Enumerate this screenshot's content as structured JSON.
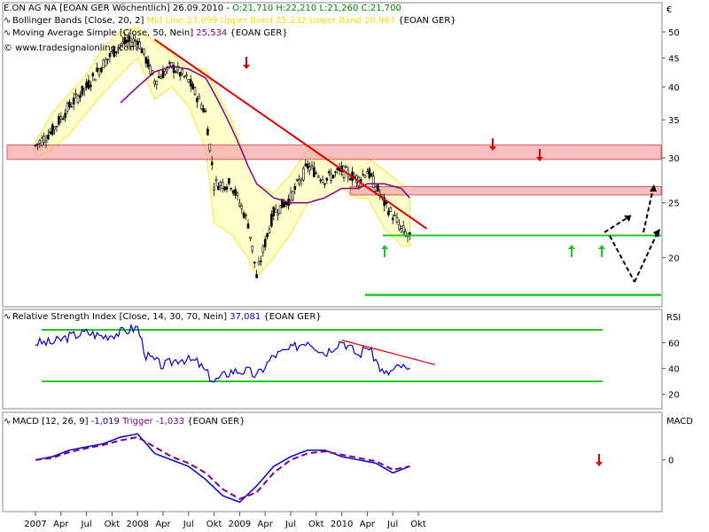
{
  "header": {
    "line1": {
      "name": "E.ON AG NA [EOAN GER  Wöchentlich]",
      "date": "26.09.2010",
      "sep": "-",
      "ohlc": "O:21,710 H:22,210 L:21,260 C:21,700"
    },
    "line2": {
      "name": "Bollinger Bands [Close, 20, 2]",
      "values": "Mid Line 23,099 Upper Band 25,232 Lower Band 20,967",
      "tag": "{EOAN GER}"
    },
    "line3": {
      "name": "Moving Average Simple [Close, 50, Nein]",
      "value": "25,534",
      "tag": "{EOAN GER}"
    },
    "line4": {
      "watermark": "© www.tradesignalonline.com"
    }
  },
  "rsi_header": {
    "name": "Relative Strength Index [Close, 14, 30, 70, Nein]",
    "value": "37,081",
    "tag": "{EOAN GER}"
  },
  "macd_header": {
    "name": "MACD [12, 26, 9]",
    "value": "-1,019",
    "trigger": "Trigger -1,033",
    "tag": "{EOAN GER}"
  },
  "axes": {
    "currency": "€",
    "price_ticks": [
      "50",
      "45",
      "40",
      "35",
      "30",
      "25",
      "20"
    ],
    "rsi_label": "RSI",
    "rsi_ticks": [
      "60",
      "40",
      "20"
    ],
    "macd_label": "MACD",
    "macd_ticks": [
      "0"
    ],
    "x_ticks": [
      "2007",
      "Apr",
      "Jul",
      "Okt",
      "2008",
      "Apr",
      "Jul",
      "Okt",
      "2009",
      "Apr",
      "Jul",
      "Okt",
      "2010",
      "Apr",
      "Jul",
      "Okt"
    ]
  },
  "colors": {
    "candle": "#000000",
    "bollinger_fill": "#ffffcc",
    "bollinger_line": "#ffd800",
    "sma": "#800080",
    "trendline": "#e00000",
    "zone_fill": "#f4a9a9",
    "support": "#22c422",
    "rsi": "#0000d0",
    "macd": "#0000d0",
    "trigger": "#800080"
  },
  "chart_data": [
    {
      "type": "line",
      "title": "E.ON AG NA [EOAN GER  Wöchentlich]",
      "x": [
        "2007-01",
        "2007-03",
        "2007-05",
        "2007-07",
        "2007-09",
        "2007-11",
        "2008-01",
        "2008-03",
        "2008-05",
        "2008-07",
        "2008-09",
        "2008-10",
        "2008-12",
        "2009-02",
        "2009-03",
        "2009-05",
        "2009-07",
        "2009-09",
        "2009-11",
        "2010-01",
        "2010-03",
        "2010-04",
        "2010-06",
        "2010-08",
        "2010-09"
      ],
      "series": [
        {
          "name": "Close",
          "values": [
            31.5,
            33.5,
            37,
            40,
            44,
            47.5,
            48.5,
            41,
            43.5,
            41,
            36,
            27,
            27,
            23,
            18.5,
            24,
            25.5,
            29,
            27.5,
            28.5,
            27.5,
            28.5,
            25,
            22.5,
            21.7
          ]
        },
        {
          "name": "Moving Average Simple [Close, 50, Nein]",
          "values": [
            null,
            null,
            null,
            null,
            null,
            37.5,
            40,
            42.5,
            43.5,
            43,
            41.5,
            39,
            34,
            29,
            27,
            25.5,
            25,
            25,
            25.5,
            26.5,
            26.5,
            27,
            27,
            26.5,
            25.5
          ]
        },
        {
          "name": "Upper Band",
          "values": [
            32,
            36,
            39,
            42,
            47,
            50,
            51,
            48,
            46,
            43,
            43,
            40,
            35,
            29,
            27,
            26,
            28,
            31,
            30,
            30,
            30,
            30,
            28.5,
            27,
            25.2
          ]
        },
        {
          "name": "Lower Band",
          "values": [
            30,
            31,
            33,
            36,
            39,
            42,
            45,
            38,
            40,
            37,
            31,
            23,
            22,
            20,
            18.5,
            20,
            22,
            25,
            25.5,
            26.5,
            25.5,
            25.5,
            22.5,
            21,
            21
          ]
        }
      ],
      "resistance_zones": [
        [
          29.8,
          31.6
        ],
        [
          25.8,
          26.7
        ]
      ],
      "support_levels": [
        21.9,
        17.2
      ],
      "trendline": [
        [
          "2008-03",
          48.5
        ],
        [
          "2010-11",
          22.5
        ]
      ],
      "ylim": [
        17,
        52
      ],
      "scale": "log"
    },
    {
      "type": "line",
      "title": "Relative Strength Index [Close, 14, 30, 70, Nein]",
      "x": [
        "2007-01",
        "2007-03",
        "2007-05",
        "2007-07",
        "2007-09",
        "2007-11",
        "2008-01",
        "2008-02",
        "2008-04",
        "2008-06",
        "2008-08",
        "2008-10",
        "2008-12",
        "2009-02",
        "2009-03",
        "2009-05",
        "2009-07",
        "2009-09",
        "2009-11",
        "2010-01",
        "2010-03",
        "2010-04",
        "2010-06",
        "2010-08",
        "2010-09"
      ],
      "series": [
        {
          "name": "RSI",
          "values": [
            60,
            60,
            65,
            68,
            65,
            68,
            72,
            50,
            42,
            48,
            45,
            30,
            38,
            38,
            34,
            50,
            55,
            62,
            52,
            62,
            50,
            58,
            35,
            42,
            37
          ]
        }
      ],
      "levels": [
        70,
        30
      ],
      "trendline": [
        [
          "2010-01",
          62
        ],
        [
          "2010-12",
          43
        ]
      ],
      "ylim": [
        10,
        80
      ]
    },
    {
      "type": "line",
      "title": "MACD [12, 26, 9]",
      "x": [
        "2007-01",
        "2007-03",
        "2007-05",
        "2007-07",
        "2007-09",
        "2007-11",
        "2008-01",
        "2008-03",
        "2008-05",
        "2008-07",
        "2008-09",
        "2008-11",
        "2009-01",
        "2009-03",
        "2009-05",
        "2009-07",
        "2009-09",
        "2009-11",
        "2010-01",
        "2010-03",
        "2010-05",
        "2010-07",
        "2010-09"
      ],
      "series": [
        {
          "name": "MACD",
          "values": [
            0,
            0.5,
            1.5,
            2,
            2.5,
            3.5,
            4,
            1,
            0,
            -1,
            -3,
            -5.5,
            -6.5,
            -4,
            -1,
            0.5,
            1.5,
            1.5,
            0.5,
            0,
            -0.5,
            -2,
            -1
          ]
        },
        {
          "name": "Trigger",
          "values": [
            0,
            0.3,
            1.2,
            1.8,
            2.3,
            3,
            3.5,
            2,
            0.5,
            -0.5,
            -2,
            -4.5,
            -6,
            -5,
            -2,
            0,
            1,
            1.3,
            0.8,
            0.3,
            -0.2,
            -1.5,
            -1
          ]
        }
      ],
      "ylim": [
        -7,
        5
      ]
    }
  ]
}
